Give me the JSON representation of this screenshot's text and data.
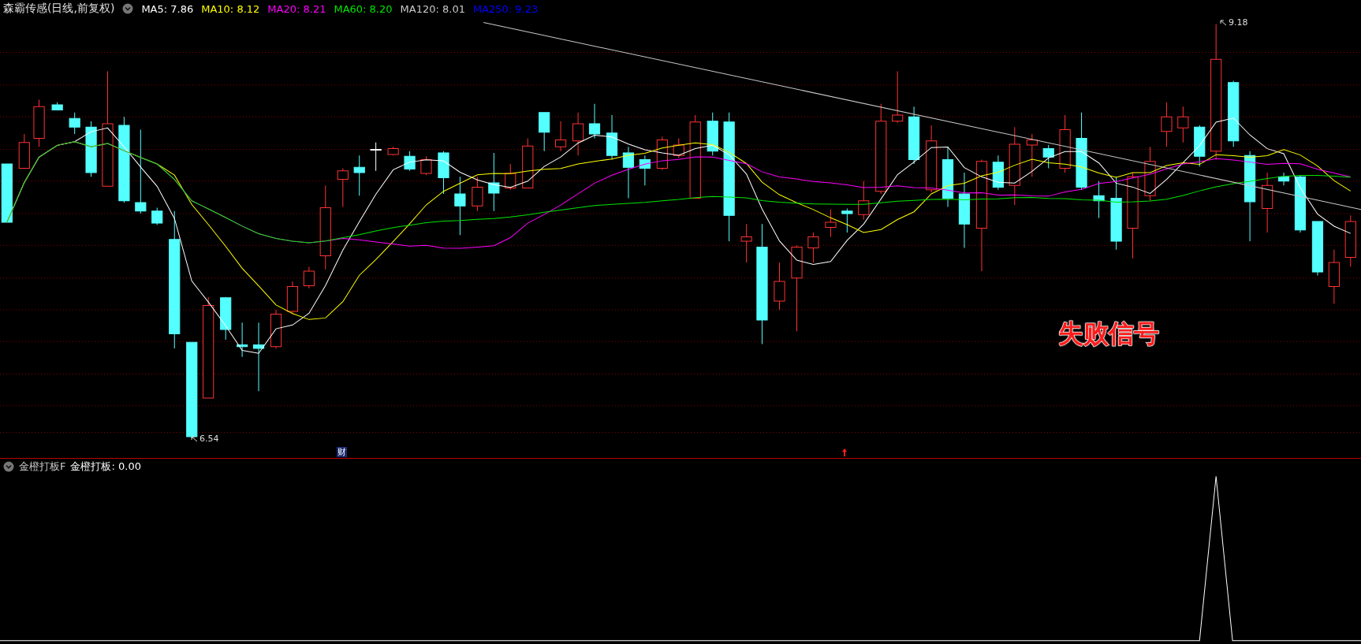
{
  "main_panel": {
    "title": "森霸传感(日线,前复权)",
    "indicators": [
      {
        "label": "MA5: 7.86",
        "color": "#ffffff"
      },
      {
        "label": "MA10: 8.12",
        "color": "#ffff00"
      },
      {
        "label": "MA20: 8.21",
        "color": "#ff00ff"
      },
      {
        "label": "MA60: 8.20",
        "color": "#00e600"
      },
      {
        "label": "MA120: 8.01",
        "color": "#c8c8c8"
      },
      {
        "label": "MA250: 9.23",
        "color": "#0000ff"
      }
    ],
    "high_label": "9.18",
    "low_label": "6.54",
    "annotation": "失败信号",
    "event_marker": "财"
  },
  "sub_panel": {
    "title": "金橙打板F",
    "reading": "金橙打板: 0.00"
  }
}
